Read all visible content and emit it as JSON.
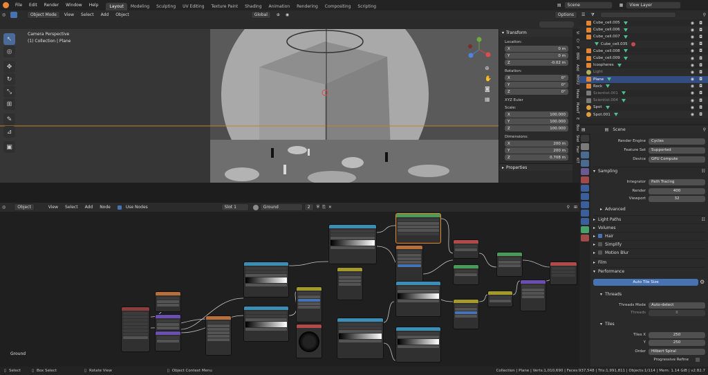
{
  "menubar": {
    "menus": [
      "File",
      "Edit",
      "Render",
      "Window",
      "Help"
    ],
    "workspaces": [
      "Layout",
      "Modeling",
      "Sculpting",
      "UV Editing",
      "Texture Paint",
      "Shading",
      "Animation",
      "Rendering",
      "Compositing",
      "Scripting"
    ],
    "active_workspace": "Layout",
    "scene": "Scene",
    "view_layer": "View Layer"
  },
  "viewport": {
    "mode": "Object Mode",
    "menus": [
      "View",
      "Select",
      "Add",
      "Object"
    ],
    "orientation": "Global",
    "options": "Options",
    "overlay_line1": "Camera Perspective",
    "overlay_line2": "(1) Collection | Plane"
  },
  "npanel": {
    "transform_title": "Transform",
    "location_label": "Location:",
    "location": [
      {
        "axis": "X",
        "value": "0 m"
      },
      {
        "axis": "Y",
        "value": "0 m"
      },
      {
        "axis": "Z",
        "value": "-0.02 m"
      }
    ],
    "rotation_label": "Rotation:",
    "rotation": [
      {
        "axis": "X",
        "value": "0°"
      },
      {
        "axis": "Y",
        "value": "0°"
      },
      {
        "axis": "Z",
        "value": "0°"
      }
    ],
    "rotation_mode": "XYZ Euler",
    "scale_label": "Scale:",
    "scale": [
      {
        "axis": "X",
        "value": "100.000"
      },
      {
        "axis": "Y",
        "value": "100.000"
      },
      {
        "axis": "Z",
        "value": "100.000"
      }
    ],
    "dimensions_label": "Dimensions:",
    "dimensions": [
      {
        "axis": "X",
        "value": "200 m"
      },
      {
        "axis": "Y",
        "value": "200 m"
      },
      {
        "axis": "Z",
        "value": "0.708 m"
      }
    ],
    "properties_title": "Properties",
    "tabs": [
      "Vi",
      "Cr",
      "P",
      "BRR",
      "Add",
      "MHX2",
      "Make",
      "MakeT",
      "E",
      "Box",
      "Skel",
      "Hair",
      "KIT"
    ]
  },
  "outliner": {
    "rows": [
      {
        "name": "Cube_cell.005",
        "type": "mesh",
        "selected": false
      },
      {
        "name": "Cube_cell.006",
        "type": "mesh",
        "selected": false
      },
      {
        "name": "Cube_cell.007",
        "type": "mesh",
        "selected": false
      },
      {
        "name": "Cube_cell.035",
        "type": "mesh",
        "selected": false
      },
      {
        "name": "Cube_cell.008",
        "type": "mesh",
        "selected": false
      },
      {
        "name": "Cube_cell.009",
        "type": "mesh",
        "selected": false
      },
      {
        "name": "Icospheres",
        "type": "mesh",
        "selected": false
      },
      {
        "name": "Light",
        "type": "light",
        "selected": false
      },
      {
        "name": "Plane",
        "type": "mesh",
        "selected": true
      },
      {
        "name": "Rock",
        "type": "mesh",
        "selected": false
      },
      {
        "name": "Scientist.001",
        "type": "armature",
        "selected": false
      },
      {
        "name": "Scientist.004",
        "type": "armature",
        "selected": false
      },
      {
        "name": "Spot",
        "type": "light",
        "selected": false
      },
      {
        "name": "Spot.001",
        "type": "light",
        "selected": false
      }
    ]
  },
  "properties": {
    "context": "Scene",
    "render_engine_label": "Render Engine",
    "render_engine": "Cycles",
    "feature_set_label": "Feature Set",
    "feature_set": "Supported",
    "device_label": "Device",
    "device": "GPU Compute",
    "sampling": "Sampling",
    "integrator_label": "Integrator",
    "integrator": "Path Tracing",
    "render_label": "Render",
    "render_samples": "400",
    "viewport_label": "Viewport",
    "viewport_samples": "32",
    "advanced": "Advanced",
    "light_paths": "Light Paths",
    "volumes": "Volumes",
    "hair": "Hair",
    "simplify": "Simplify",
    "motion_blur": "Motion Blur",
    "film": "Film",
    "performance": "Performance",
    "auto_tile_size": "Auto Tile Size",
    "threads": "Threads",
    "threads_mode_label": "Threads Mode",
    "threads_mode": "Auto-detect",
    "threads_label": "Threads",
    "threads_value": "8",
    "tiles": "Tiles",
    "tiles_x_label": "Tiles X",
    "tiles_x": "250",
    "tiles_y_label": "Y",
    "tiles_y": "250",
    "order_label": "Order",
    "order": "Hilbert Spiral",
    "progressive_refine": "Progressive Refine"
  },
  "node_editor": {
    "type": "Object",
    "menus": [
      "View",
      "Select",
      "Add",
      "Node"
    ],
    "use_nodes": "Use Nodes",
    "slot": "Slot 1",
    "material": "Ground",
    "users": "2",
    "material_label": "Ground"
  },
  "statusbar": {
    "select": "Select",
    "box_select": "Box Select",
    "rotate_view": "Rotate View",
    "context_menu": "Object Context Menu",
    "stats": "Collection | Plane | Verts:1,010,690 | Faces:937,548 | Tris:1,991,811 | Objects:1/114 | Mem: 1.14 GiB | v2.82.7"
  },
  "colors": {
    "accent": "#4772b3",
    "selection": "#334d80",
    "mesh_icon": "#e28535",
    "data_icon": "#4fc08d",
    "header_bg": "#2b2b2b",
    "panel_bg": "#2a2a2a"
  }
}
